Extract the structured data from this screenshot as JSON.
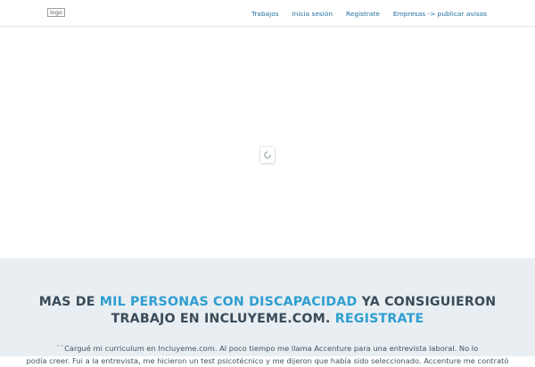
{
  "header": {
    "logo_alt": "logo",
    "nav": [
      {
        "label": "Trabajos"
      },
      {
        "label": "Inicia sesión"
      },
      {
        "label": "Registrate"
      },
      {
        "label": "Empresas -> publicar avisos"
      }
    ]
  },
  "hero": {
    "line1_a": "MAS DE ",
    "line1_b": "MIL PERSONAS CON DISCAPACIDAD",
    "line1_c": " YA CONSIGUIERON",
    "line2_a": "TRABAJO EN INCLUYEME.COM. ",
    "line2_b": "REGISTRATE",
    "testimonial_line1": "``Cargué mi curriculum en Incluyeme.com. Al poco tiempo me llama Accenture para una entrevista laboral. No lo",
    "testimonial_line2": "podía creer. Fui a la entrevista, me hicieron un test psicotécnico y me dijeron que había sido seleccionado. Accenture me contrató"
  },
  "colors": {
    "nav_link": "#1f6f9f",
    "headline": "#3b4b59",
    "accent": "#2f9ed1",
    "hero_bg": "#e8eef1"
  }
}
